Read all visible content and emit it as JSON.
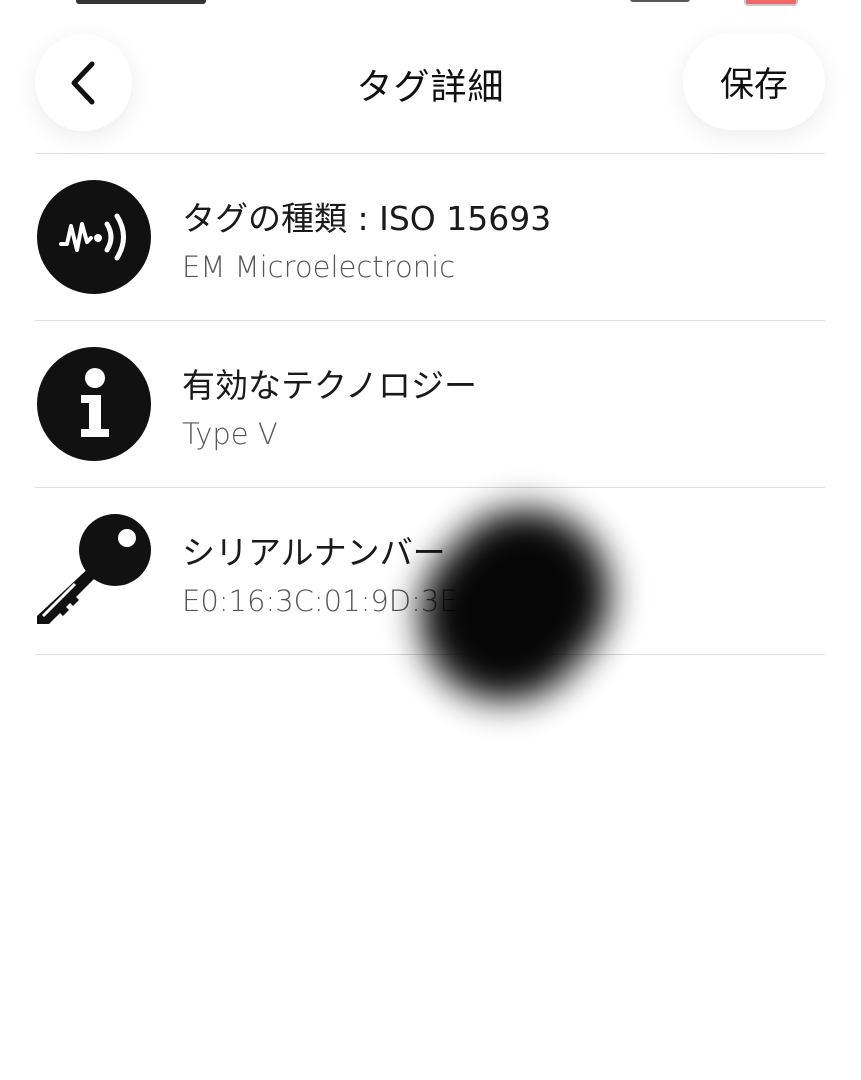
{
  "header": {
    "title": "タグ詳細",
    "save_label": "保存"
  },
  "rows": [
    {
      "icon": "nfc-wave-icon",
      "title": "タグの種類 : ISO 15693",
      "subtitle": "EM Microelectronic"
    },
    {
      "icon": "info-icon",
      "title": "有効なテクノロジー",
      "subtitle": "Type V"
    },
    {
      "icon": "key-icon",
      "title": "シリアルナンバー",
      "subtitle": "E0:16:3C:01:9D:3E"
    }
  ]
}
